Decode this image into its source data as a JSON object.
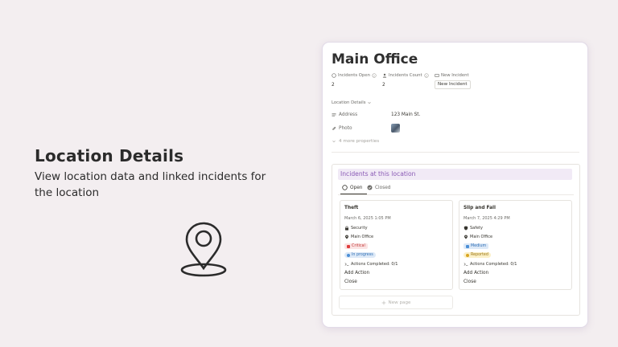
{
  "promo": {
    "title": "Location Details",
    "subtitle": "View location data and linked incidents for the location"
  },
  "page": {
    "title": "Main Office",
    "properties": {
      "incidents_open": {
        "label": "Incidents Open",
        "value": "2"
      },
      "incidents_count": {
        "label": "Incidents Count",
        "value": "2"
      },
      "new_incident": {
        "label": "New Incident",
        "button_label": "New Incident"
      }
    },
    "section_label": "Location Details",
    "address": {
      "label": "Address",
      "value": "123 Main St."
    },
    "photo": {
      "label": "Photo"
    },
    "more_properties": "4 more properties"
  },
  "linked": {
    "title": "Incidents at this location",
    "tabs": [
      {
        "label": "Open",
        "active": true
      },
      {
        "label": "Closed",
        "active": false
      }
    ],
    "cards": [
      {
        "title": "Theft",
        "date": "March 6, 2025 1:05 PM",
        "category": "Security",
        "location": "Main Office",
        "severity": "Critical",
        "status": "In progress",
        "actions": "Actions Completed: 0/1",
        "add_action": "Add Action",
        "close": "Close"
      },
      {
        "title": "Slip and Fall",
        "date": "March 7, 2025 4:29 PM",
        "category": "Safety",
        "location": "Main Office",
        "severity": "Medium",
        "status": "Reported",
        "actions": "Actions Completed: 0/1",
        "add_action": "Add Action",
        "close": "Close"
      }
    ],
    "new_page": "New page"
  },
  "colors": {
    "background": "#f3eef0",
    "accent_purple": "#8a5ab5",
    "critical": "#e03e3e",
    "critical_bg": "#fbe4e4",
    "medium": "#4c8fd6",
    "medium_bg": "#dde9f7",
    "in_progress": "#4c8fd6",
    "in_progress_bg": "#dde9f7",
    "reported": "#d9a521",
    "reported_bg": "#fbf0c8"
  }
}
